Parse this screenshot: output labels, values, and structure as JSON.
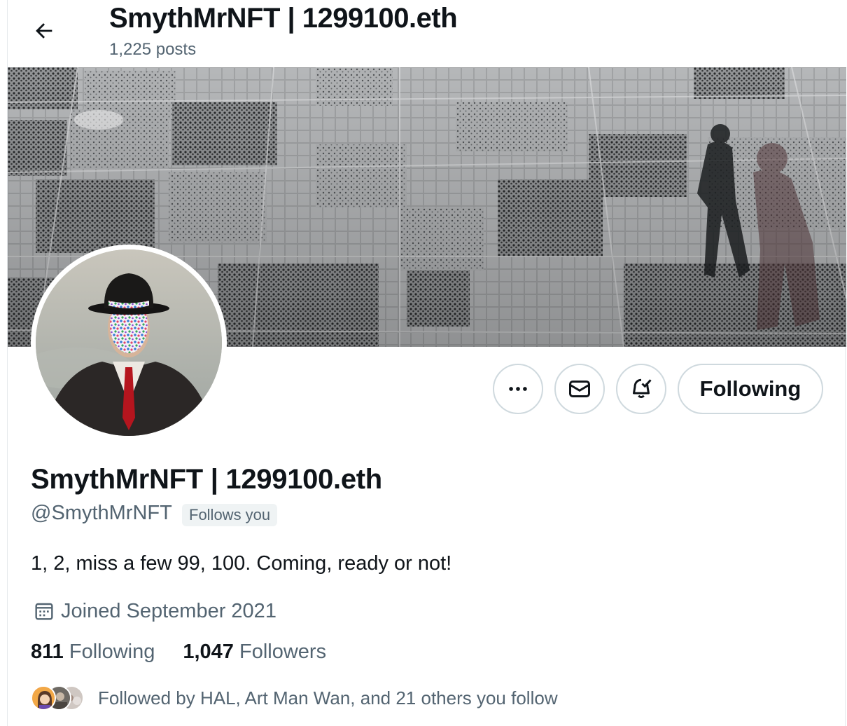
{
  "header": {
    "back_icon": "arrow-left-icon",
    "title": "SmythMrNFT | 1299100.eth",
    "post_count": "1,225 posts"
  },
  "profile": {
    "display_name": "SmythMrNFT | 1299100.eth",
    "handle": "@SmythMrNFT",
    "follows_you_badge": "Follows you",
    "bio": "1, 2, miss a few 99, 100. Coming, ready or not!",
    "joined": "Joined September 2021",
    "following_count": "811",
    "following_label": "Following",
    "followers_count": "1,047",
    "followers_label": "Followers",
    "followed_by": "Followed by HAL, Art Man Wan, and 21 others you follow"
  },
  "actions": {
    "more_icon": "more-horizontal-icon",
    "message_icon": "envelope-icon",
    "notify_icon": "bell-check-icon",
    "following_button": "Following"
  },
  "colors": {
    "text_primary": "#0f1419",
    "text_secondary": "#536471",
    "border": "#cfd9de",
    "badge_bg": "#eff3f4"
  }
}
